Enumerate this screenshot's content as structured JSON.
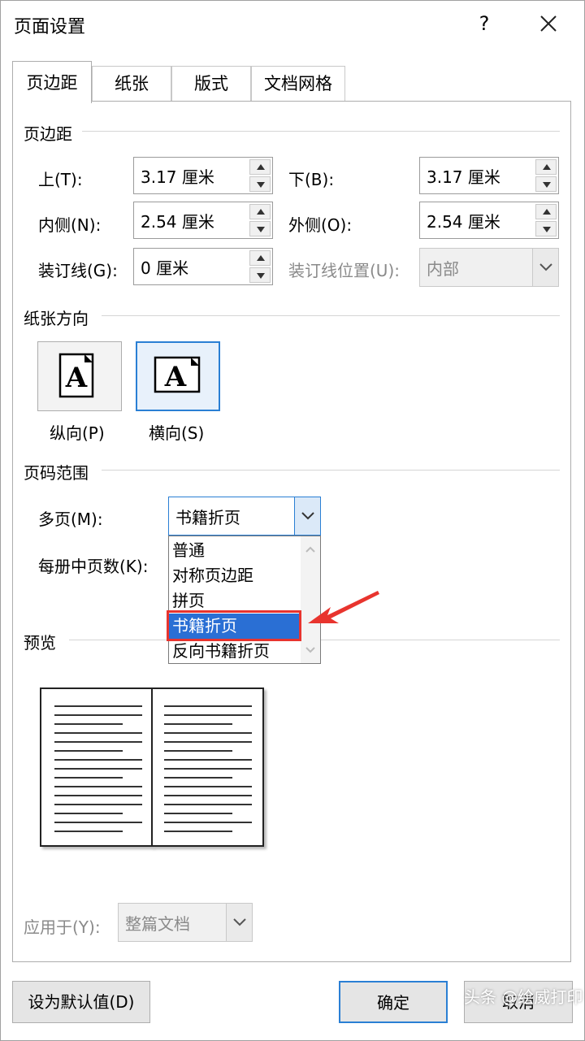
{
  "window": {
    "title": "页面设置",
    "help": "?",
    "close_icon": "close-icon"
  },
  "tabs": [
    "页边距",
    "纸张",
    "版式",
    "文档网格"
  ],
  "margins": {
    "group_title": "页边距",
    "top_label": "上(T):",
    "top_value": "3.17 厘米",
    "bottom_label": "下(B):",
    "bottom_value": "3.17 厘米",
    "inside_label": "内侧(N):",
    "inside_value": "2.54 厘米",
    "outside_label": "外侧(O):",
    "outside_value": "2.54 厘米",
    "gutter_label": "装订线(G):",
    "gutter_value": "0 厘米",
    "gutter_pos_label": "装订线位置(U):",
    "gutter_pos_value": "内部"
  },
  "orientation": {
    "group_title": "纸张方向",
    "portrait_label": "纵向(P)",
    "landscape_label": "横向(S)",
    "glyph": "A"
  },
  "pages": {
    "group_title": "页码范围",
    "multiple_label": "多页(M):",
    "multiple_value": "书籍折页",
    "sheets_label": "每册中页数(K):",
    "dropdown_options": [
      "普通",
      "对称页边距",
      "拼页",
      "书籍折页",
      "反向书籍折页"
    ],
    "selected_index": 3
  },
  "preview": {
    "group_title": "预览"
  },
  "apply": {
    "label": "应用于(Y):",
    "value": "整篇文档"
  },
  "buttons": {
    "default": "设为默认值(D)",
    "ok": "确定",
    "cancel": "取消"
  },
  "watermark": "头条 @绘威打印",
  "colors": {
    "accent": "#2a7fd4",
    "selection": "#2a6fd4",
    "highlight": "#e8342e"
  }
}
